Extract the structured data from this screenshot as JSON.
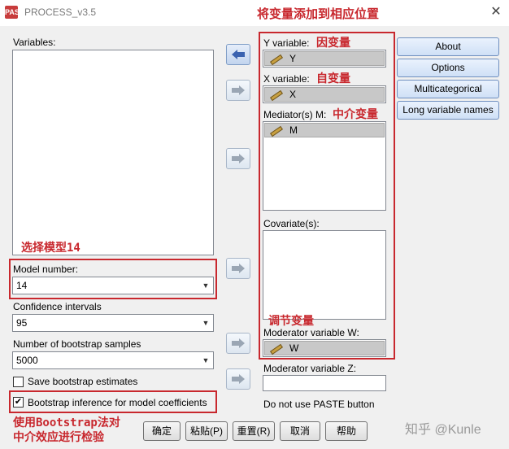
{
  "window": {
    "icon_label": "PASW",
    "title": "PROCESS_v3.5",
    "close_glyph": "✕"
  },
  "left": {
    "variables_label": "Variables:",
    "model_number": {
      "label": "Model number:",
      "value": "14"
    },
    "confidence": {
      "label": "Confidence intervals",
      "value": "95"
    },
    "bootstrap_samples": {
      "label": "Number of bootstrap samples",
      "value": "5000"
    },
    "save_bootstrap": {
      "label": "Save bootstrap estimates",
      "checked": false
    },
    "bootstrap_inference": {
      "label": "Bootstrap inference for model coefficients",
      "checked": true,
      "check_glyph": "✔"
    }
  },
  "middle": {
    "y_label": "Y variable:",
    "y_value": "Y",
    "x_label": "X variable:",
    "x_value": "X",
    "mediator_label": "Mediator(s) M:",
    "mediator_value": "M",
    "covariates_label": "Covariate(s):",
    "moderator_w_label": "Moderator variable W:",
    "moderator_w_value": "W",
    "moderator_z_label": "Moderator variable Z:",
    "moderator_z_value": "",
    "paste_note": "Do not use PASTE button"
  },
  "side_buttons": [
    "About",
    "Options",
    "Multicategorical",
    "Long variable names"
  ],
  "bottom_buttons": {
    "ok": "确定",
    "paste": "粘贴(P)",
    "reset": "重置(R)",
    "cancel": "取消",
    "help": "帮助"
  },
  "annotations": {
    "top": "将变量添加到相应位置",
    "y": "因变量",
    "x": "自变量",
    "mediator": "中介变量",
    "model": "选择模型14",
    "moderator": "调节变量",
    "bootstrap_line1": "使用Bootstrap法对",
    "bootstrap_line2": "中介效应进行检验"
  },
  "watermark": "知乎 @Kunle",
  "colors": {
    "annotation_red": "#c8282e",
    "side_button_blue": "#cfe0f6",
    "active_arrow_blue": "#3a62b0"
  }
}
